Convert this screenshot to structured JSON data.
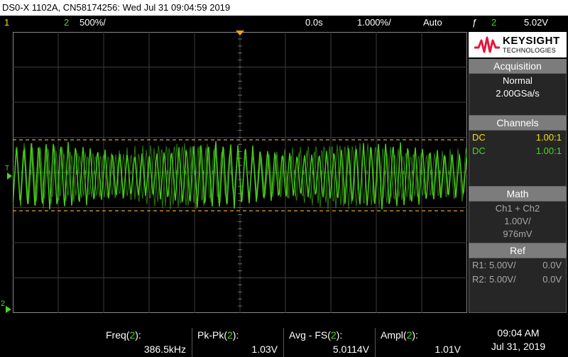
{
  "title_bar": "DS0-X 1102A, CN58174256: Wed Jul 31 09:04:59 2019",
  "status": {
    "ch1_num": "1",
    "ch2_num": "2",
    "ch2_scale": "500%/",
    "time_offset": "0.0s",
    "time_scale": "1.000%/",
    "trigger_mode": "Auto",
    "trigger_symbol": "ƒ",
    "trigger_source": "2",
    "trigger_level": "5.02V"
  },
  "screen_markers": {
    "trigger_marker": "T",
    "ch2_ground_marker": "2"
  },
  "logo": {
    "brand": "KEYSIGHT",
    "sub": "TECHNOLOGIES"
  },
  "acquisition": {
    "header": "Acquisition",
    "mode": "Normal",
    "rate": "2.00GSa/s"
  },
  "channels": {
    "header": "Channels",
    "rows": [
      {
        "coupling": "DC",
        "probe": "1.00:1"
      },
      {
        "coupling": "DC",
        "probe": "1.00:1"
      }
    ]
  },
  "math": {
    "header": "Math",
    "function": "Ch1 + Ch2",
    "scale": "1.00V/",
    "offset": "976mV"
  },
  "ref": {
    "header": "Ref",
    "rows": [
      {
        "name": "R1:",
        "scale": "5.00V/",
        "offset": "0.0V"
      },
      {
        "name": "R2:",
        "scale": "5.00V/",
        "offset": "0.0V"
      }
    ]
  },
  "measurements": [
    {
      "name": "Freq(",
      "src": "2",
      "close": "):",
      "value": "386.5kHz"
    },
    {
      "name": "Pk-Pk(",
      "src": "2",
      "close": "):",
      "value": "1.03V"
    },
    {
      "name": "Avg - FS(",
      "src": "2",
      "close": "):",
      "value": "5.0114V"
    },
    {
      "name": "Ampl(",
      "src": "2",
      "close": "):",
      "value": "1.01V"
    }
  ],
  "clock": {
    "time": "09:04 AM",
    "date": "Jul 31, 2019"
  },
  "colors": {
    "ch1": "#f5e300",
    "ch2": "#4cd61d",
    "trigger_marker": "#f5a020",
    "cursor_dash": "#e8a020",
    "panel_header": "#7c7c7c",
    "logo_red": "#e4173e"
  }
}
